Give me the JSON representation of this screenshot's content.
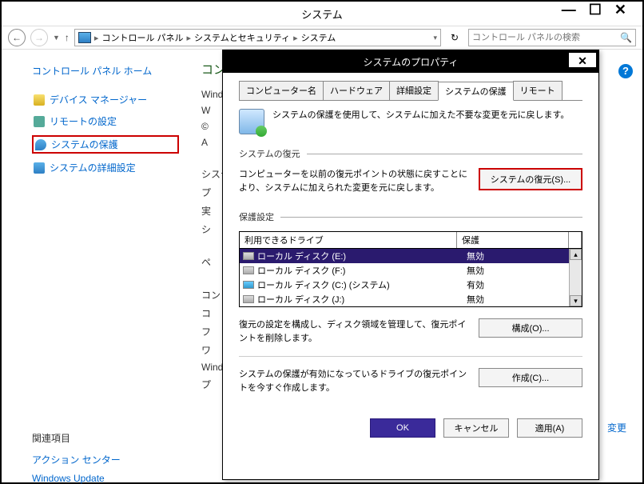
{
  "titlebar": {
    "title": "システム"
  },
  "toolbar": {
    "breadcrumb": {
      "root": "コントロール パネル",
      "mid": "システムとセキュリティ",
      "leaf": "システム"
    },
    "search_placeholder": "コントロール パネルの検索"
  },
  "sidebar": {
    "home": "コントロール パネル ホーム",
    "items": [
      {
        "label": "デバイス マネージャー"
      },
      {
        "label": "リモートの設定"
      },
      {
        "label": "システムの保護"
      },
      {
        "label": "システムの詳細設定"
      }
    ],
    "related_title": "関連項目",
    "related_items": [
      "アクション センター",
      "Windows Update"
    ]
  },
  "main": {
    "heading": "コン",
    "rows": [
      "Wind",
      "W",
      "©",
      "A",
      "システ",
      "プ",
      "実",
      "シ",
      "ペ",
      "コンピ",
      "コ",
      "フ",
      "ワ",
      "Wind",
      "プ"
    ],
    "change_link": "変更"
  },
  "dialog": {
    "title": "システムのプロパティ",
    "tabs": [
      "コンピューター名",
      "ハードウェア",
      "詳細設定",
      "システムの保護",
      "リモート"
    ],
    "active_tab": 3,
    "intro": "システムの保護を使用して、システムに加えた不要な変更を元に戻します。",
    "restore_section_label": "システムの復元",
    "restore_text": "コンピューターを以前の復元ポイントの状態に戻すことにより、システムに加えられた変更を元に戻します。",
    "restore_button": "システムの復元(S)...",
    "protection_section_label": "保護設定",
    "table_headers": {
      "drive": "利用できるドライブ",
      "protection": "保護"
    },
    "drives": [
      {
        "name": "ローカル ディスク (E:)",
        "protection": "無効",
        "selected": true
      },
      {
        "name": "ローカル ディスク (F:)",
        "protection": "無効"
      },
      {
        "name": "ローカル ディスク (C:) (システム)",
        "protection": "有効",
        "win": true
      },
      {
        "name": "ローカル ディスク (J:)",
        "protection": "無効"
      }
    ],
    "configure_text": "復元の設定を構成し、ディスク領域を管理して、復元ポイントを削除します。",
    "configure_button": "構成(O)...",
    "create_text": "システムの保護が有効になっているドライブの復元ポイントを今すぐ作成します。",
    "create_button": "作成(C)...",
    "buttons": {
      "ok": "OK",
      "cancel": "キャンセル",
      "apply": "適用(A)"
    }
  }
}
